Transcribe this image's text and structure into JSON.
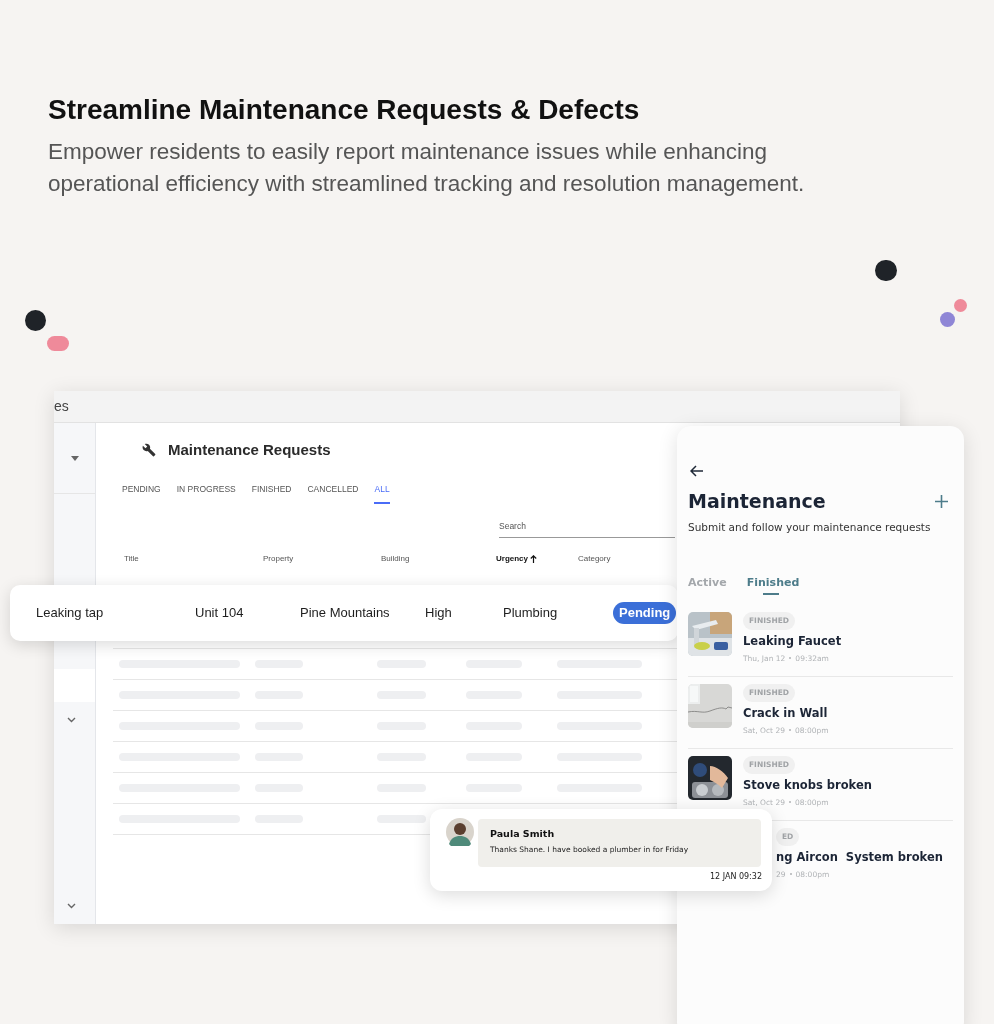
{
  "headline": {
    "title": "Streamline Maintenance Requests & Defects",
    "subtitle": "Empower residents to easily report maintenance issues while enhancing operational efficiency with streamlined tracking and resolution management."
  },
  "desktop_window": {
    "title": "es",
    "page_title": "Maintenance Requests",
    "tabs": [
      {
        "label": "PENDING",
        "selected": false
      },
      {
        "label": "IN PROGRESS",
        "selected": false
      },
      {
        "label": "FINISHED",
        "selected": false
      },
      {
        "label": "CANCELLED",
        "selected": false
      },
      {
        "label": "ALL",
        "selected": true
      }
    ],
    "search": {
      "placeholder": "Search"
    },
    "table": {
      "columns": [
        {
          "label": "Title",
          "sorted": false
        },
        {
          "label": "Property",
          "sorted": false
        },
        {
          "label": "Building",
          "sorted": false
        },
        {
          "label": "Urgency",
          "sorted": true
        },
        {
          "label": "Category",
          "sorted": false
        }
      ],
      "highlighted_row": {
        "cells": [
          "Leaking tap",
          "Unit 104",
          "Pine Mountains",
          "High",
          "Plumbing"
        ],
        "status": "Pending"
      }
    }
  },
  "mobile": {
    "title": "Maintenance",
    "subtitle": "Submit and follow your maintenance requests",
    "tabs": [
      {
        "label": "Active",
        "selected": false
      },
      {
        "label": "Finished",
        "selected": true
      }
    ],
    "requests": [
      {
        "kind": "picture",
        "status": "FINISHED",
        "title": "Leaking Faucet",
        "date": "Thu, Jan 12",
        "time": "09:32am"
      },
      {
        "kind": "picture",
        "status": "FINISHED",
        "title": "Crack in Wall",
        "date": "Sat, Oct 29",
        "time": "08:00pm"
      },
      {
        "kind": "picture",
        "status": "FINISHED",
        "title": "Stove knobs broken",
        "date": "Sat, Oct 29",
        "time": "08:00pm"
      },
      {
        "kind": "text",
        "status": "ED",
        "title": "ng Aircon  System broken",
        "date": "29",
        "time": "08:00pm"
      }
    ]
  },
  "chat": {
    "name": "Paula Smith",
    "message": "Thanks Shane. I have booked a plumber in for Friday",
    "time": "12 JAN 09:32"
  }
}
